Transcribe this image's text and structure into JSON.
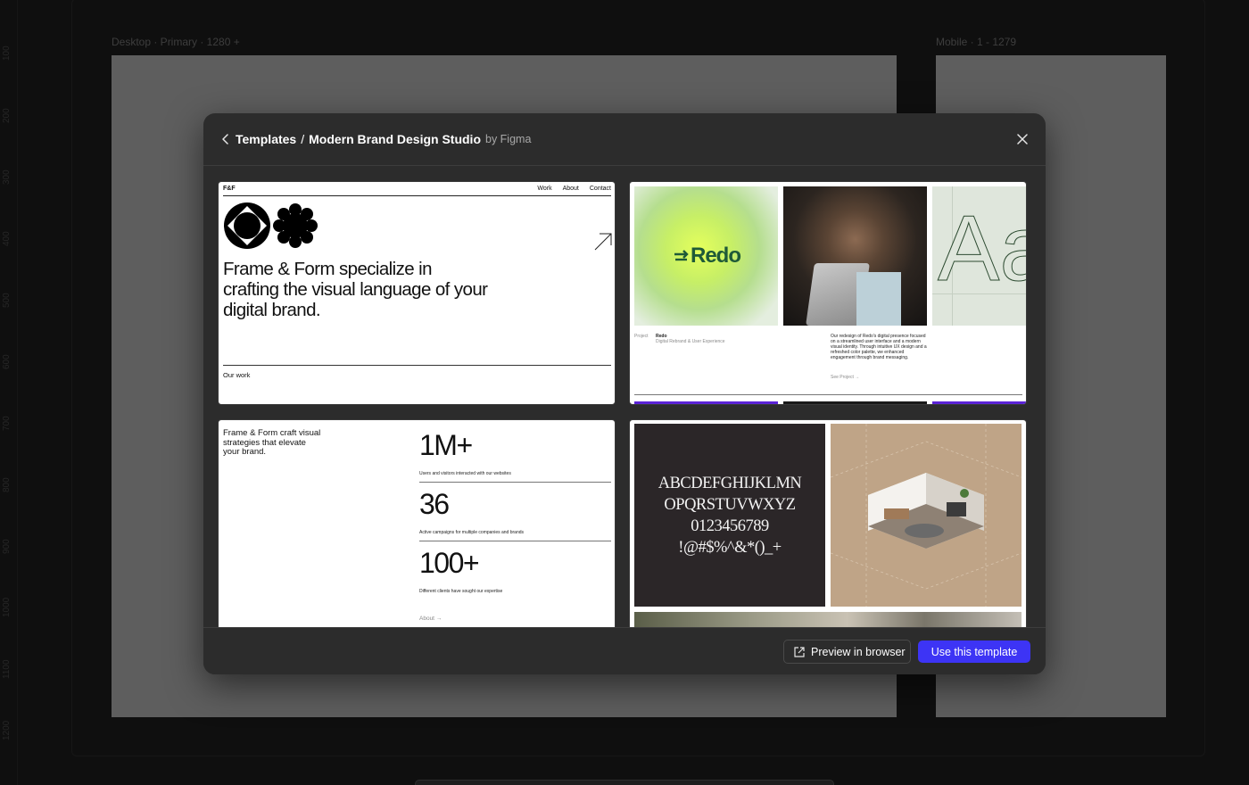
{
  "canvas": {
    "ruler_ticks": [
      "100",
      "200",
      "300",
      "400",
      "500",
      "600",
      "700",
      "800",
      "900",
      "1000",
      "1100",
      "1200"
    ],
    "frames": [
      {
        "label": "Desktop · Primary · 1280 +"
      },
      {
        "label": "Mobile · 1 - 1279"
      }
    ]
  },
  "modal": {
    "breadcrumb_root": "Templates",
    "breadcrumb_separator": "/",
    "template_name": "Modern Brand Design Studio",
    "author": "by Figma",
    "preview_button": "Preview in browser",
    "use_button": "Use this template",
    "accent_color": "#3d34f5"
  },
  "thumb1": {
    "logo": "F&F",
    "nav": [
      "Work",
      "About",
      "Contact"
    ],
    "headline": "Frame & Form specialize in crafting the visual language of your digital brand.",
    "section": "Our work"
  },
  "thumb2": {
    "brand": "Redo",
    "project_label": "Project",
    "project_name": "Redo",
    "project_sub": "Digital Rebrand & User Experience",
    "description": "Our redesign of Redo's digital presence focused on a streamlined user interface and a modern visual identity. Through intuitive UX design and a refreshed color palette, we enhanced engagement through brand messaging.",
    "see_project": "See Project →",
    "specimen": "Aa"
  },
  "thumb3": {
    "headline": "Frame & Form craft visual strategies that elevate your brand.",
    "stats": [
      {
        "value": "1M+",
        "caption": "Users and visitors interacted with our websites"
      },
      {
        "value": "36",
        "caption": "Active campaigns for multiple companies and brands"
      },
      {
        "value": "100+",
        "caption": "Different clients have sought our expertise"
      }
    ],
    "about_link": "About →"
  },
  "thumb4": {
    "glyph_lines": [
      "ABCDEFGHIJKLMN",
      "OPQRSTUVWXYZ",
      "0123456789",
      "!@#$%^&*()_+"
    ]
  }
}
